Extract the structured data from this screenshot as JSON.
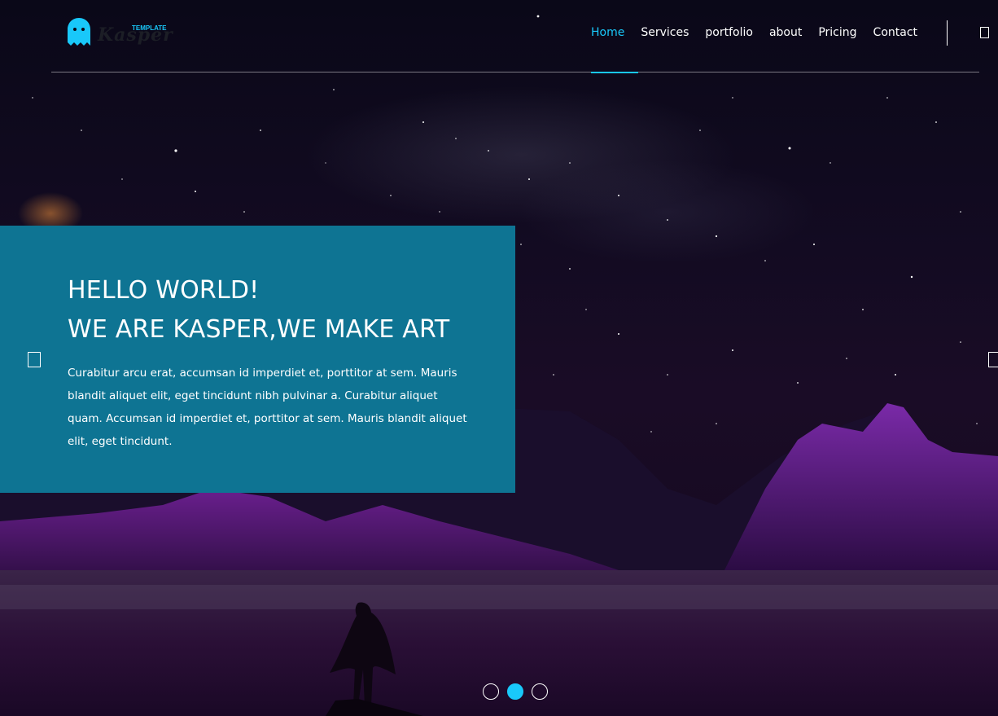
{
  "header": {
    "logo": {
      "tag": "TEMPLATE",
      "word": "Kasper",
      "icon": "ghost-icon"
    },
    "nav": [
      {
        "label": "Home",
        "active": true
      },
      {
        "label": "Services",
        "active": false
      },
      {
        "label": "portfolio",
        "active": false
      },
      {
        "label": "about",
        "active": false
      },
      {
        "label": "Pricing",
        "active": false
      },
      {
        "label": "Contact",
        "active": false
      }
    ],
    "search_icon": "search-icon"
  },
  "hero": {
    "headline_line1": "HELLO WORLD!",
    "headline_line2": "WE ARE KASPER,WE MAKE ART",
    "paragraph": "Curabitur arcu erat, accumsan id imperdiet et, porttitor at sem. Mauris blandit aliquet elit, eget tincidunt nibh pulvinar a. Curabitur aliquet quam. Accumsan id imperdiet et, porttitor at sem. Mauris blandit aliquet elit, eget tincidunt.",
    "prev_icon": "chevron-left-icon",
    "next_icon": "chevron-right-icon"
  },
  "slider": {
    "dots": 3,
    "active_index": 1
  },
  "colors": {
    "accent": "#19c8fa",
    "box": "#0e7493",
    "text": "#ffffff"
  }
}
